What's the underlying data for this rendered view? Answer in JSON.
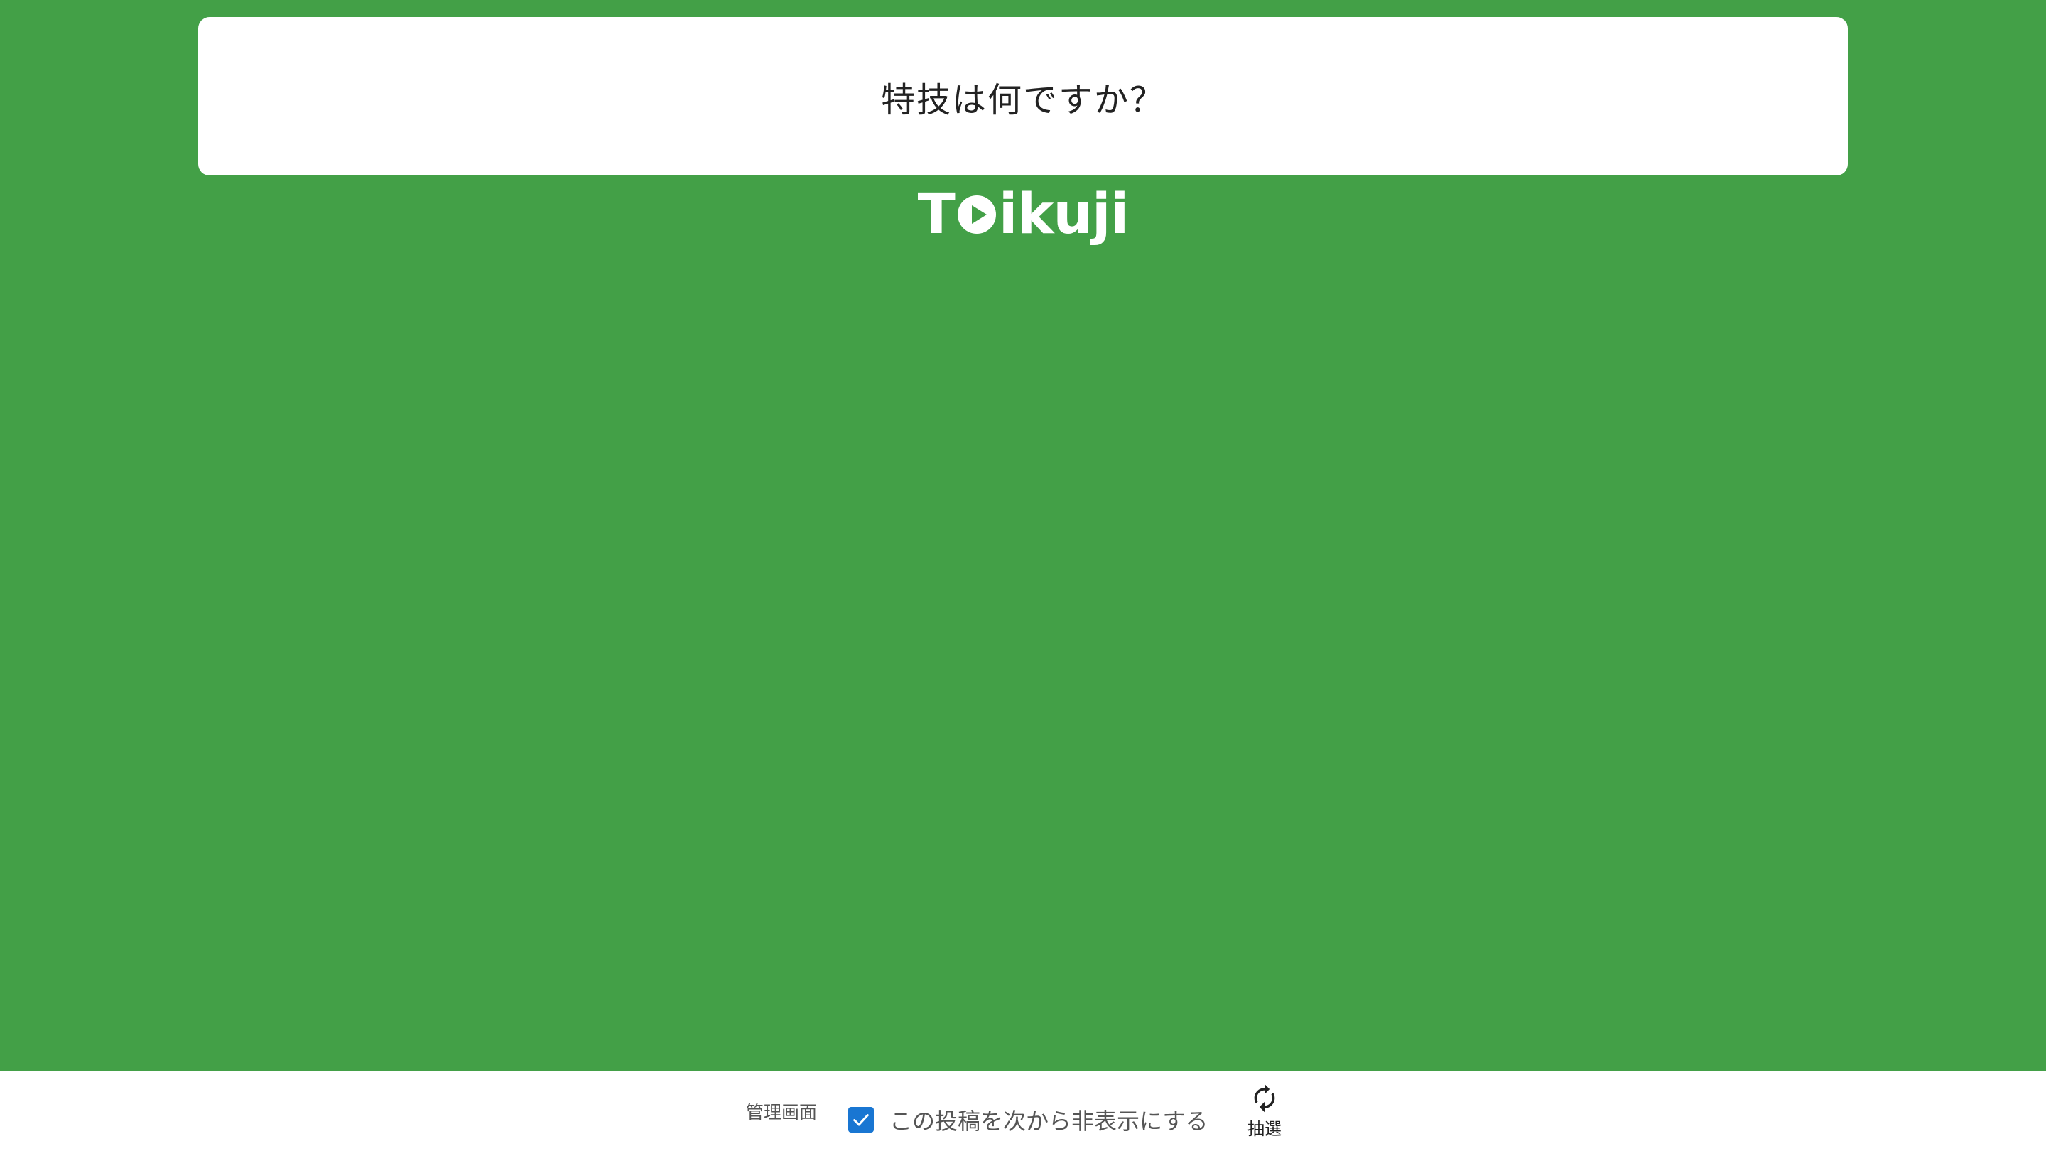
{
  "question": {
    "text": "特技は何ですか？"
  },
  "logo": {
    "text_before": "T",
    "text_after": "ikuji",
    "icon": "play-icon"
  },
  "bottom_bar": {
    "admin_label": "管理画面",
    "hide_checkbox": {
      "label": "この投稿を次から非表示にする",
      "checked": true
    },
    "draw_button": {
      "label": "抽選",
      "icon": "refresh-icon"
    }
  },
  "colors": {
    "background": "#43a047",
    "card": "#ffffff",
    "checkbox": "#1976d2"
  }
}
